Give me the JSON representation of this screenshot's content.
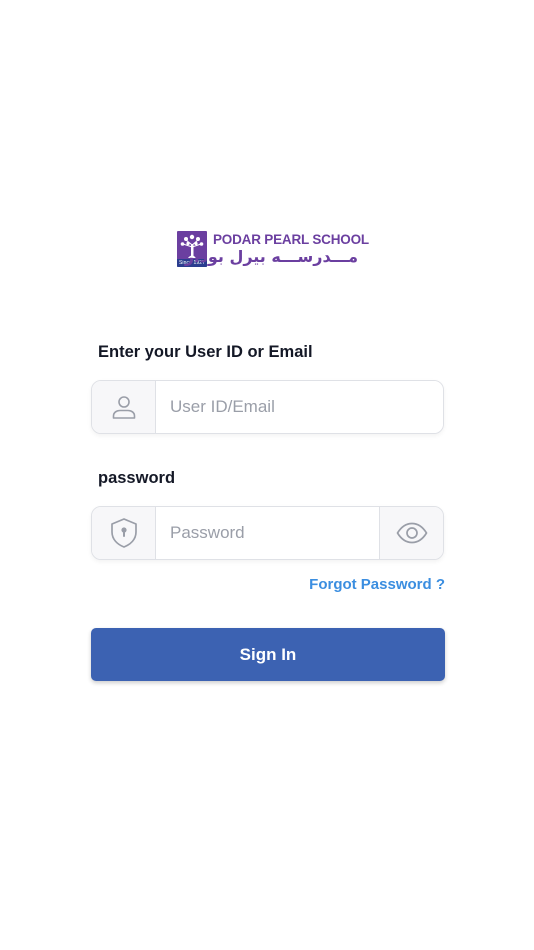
{
  "brand": {
    "name": "PODAR PEARL SCHOOL",
    "name_arabic": "مـــدرســـه بيرل بودار",
    "since": "Since 1927",
    "color": "#6b3fa0"
  },
  "form": {
    "userid_label": "Enter your User ID or Email",
    "userid_placeholder": "User ID/Email",
    "userid_icon": "user-icon",
    "password_label": "password",
    "password_placeholder": "Password",
    "password_icon": "shield-lock-icon",
    "visibility_icon": "eye-icon",
    "forgot_label": "Forgot Password ?",
    "signin_label": "Sign In"
  },
  "colors": {
    "primary": "#3c62b2",
    "link": "#3b8ee0",
    "label": "#141826",
    "placeholder": "#9a9ea8",
    "border": "#dfe1e6"
  }
}
